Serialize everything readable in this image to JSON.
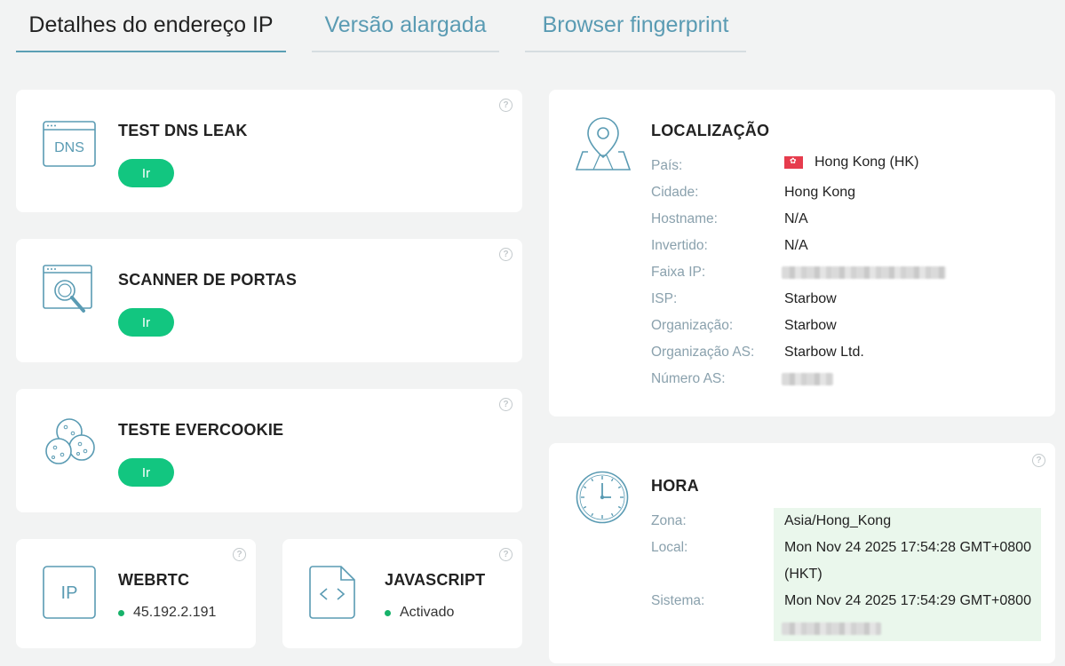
{
  "tabs": [
    {
      "label": "Detalhes do endereço IP",
      "active": true
    },
    {
      "label": "Versão alargada",
      "active": false
    },
    {
      "label": "Browser fingerprint",
      "active": false
    }
  ],
  "tools": {
    "dns": {
      "title": "TEST DNS LEAK",
      "button": "Ir",
      "icon_text": "DNS",
      "icon": "dns-window-icon"
    },
    "ports": {
      "title": "SCANNER DE PORTAS",
      "button": "Ir",
      "icon": "magnifier-window-icon"
    },
    "evercookie": {
      "title": "TESTE EVERCOOKIE",
      "button": "Ir",
      "icon": "cookie-icon"
    },
    "webrtc": {
      "title": "WEBRTC",
      "value": "45.192.2.191",
      "icon_text": "IP",
      "icon": "ip-box-icon"
    },
    "javascript": {
      "title": "JAVASCRIPT",
      "value": "Activado",
      "icon": "code-file-icon"
    }
  },
  "help_symbol": "?",
  "location": {
    "title": "LOCALIZAÇÃO",
    "icon": "map-pin-icon",
    "rows": {
      "country": {
        "label": "País:",
        "value": "Hong Kong (HK)"
      },
      "city": {
        "label": "Cidade:",
        "value": "Hong Kong"
      },
      "hostname": {
        "label": "Hostname:",
        "value": "N/A"
      },
      "reverse": {
        "label": "Invertido:",
        "value": "N/A"
      },
      "ip_range": {
        "label": "Faixa IP:"
      },
      "isp": {
        "label": "ISP:",
        "value": "Starbow"
      },
      "org": {
        "label": "Organização:",
        "value": "Starbow"
      },
      "as_org": {
        "label": "Organização AS:",
        "value": "Starbow Ltd."
      },
      "as_number": {
        "label": "Número AS:"
      }
    }
  },
  "time": {
    "title": "HORA",
    "icon": "clock-icon",
    "zone": {
      "label": "Zona:",
      "value": "Asia/Hong_Kong"
    },
    "local": {
      "label": "Local:",
      "value": "Mon Nov 24 2025 17:54:28 GMT+0800",
      "value2": "(HKT)"
    },
    "system": {
      "label": "Sistema:",
      "value": "Mon Nov 24 2025 17:54:29 GMT+0800"
    }
  },
  "colors": {
    "accent": "#5a9bb3",
    "button": "#12c680",
    "status_dot": "#17b26a",
    "highlight": "#eaf7ec"
  }
}
